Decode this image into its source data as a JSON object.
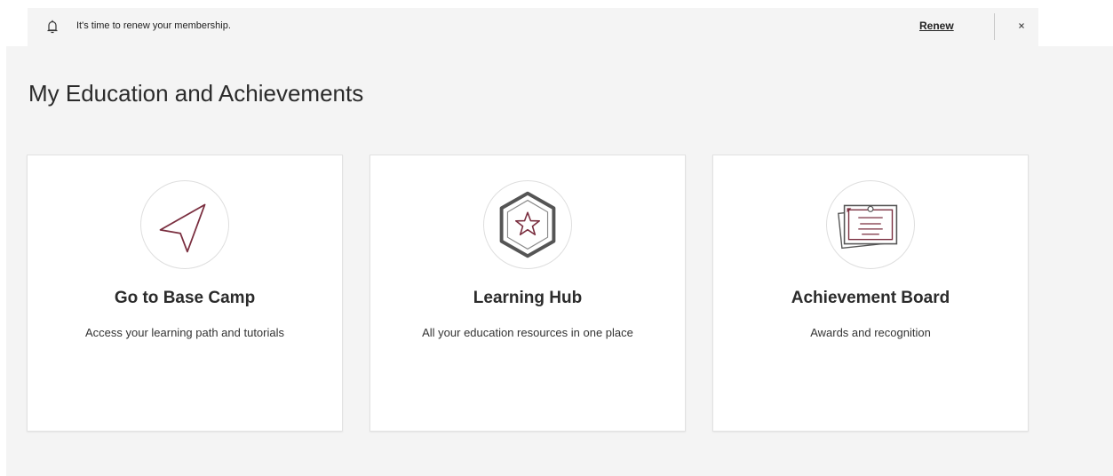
{
  "banner": {
    "icon": "bell-icon",
    "message": "It's time to renew your membership.",
    "action_label": "Renew",
    "close_icon": "close-icon"
  },
  "page": {
    "title": "My Education and Achievements"
  },
  "cards": [
    {
      "icon": "navigation-arrow-icon",
      "title": "Go to Base Camp",
      "description": "Access your learning path and tutorials"
    },
    {
      "icon": "star-badge-icon",
      "title": "Learning Hub",
      "description": "All your education resources in one place"
    },
    {
      "icon": "certificate-icon",
      "title": "Achievement Board",
      "description": "Awards and recognition"
    }
  ],
  "colors": {
    "accent": "#7a2e3f",
    "background": "#f4f4f4",
    "card": "#ffffff",
    "text": "#2b2b2b"
  }
}
